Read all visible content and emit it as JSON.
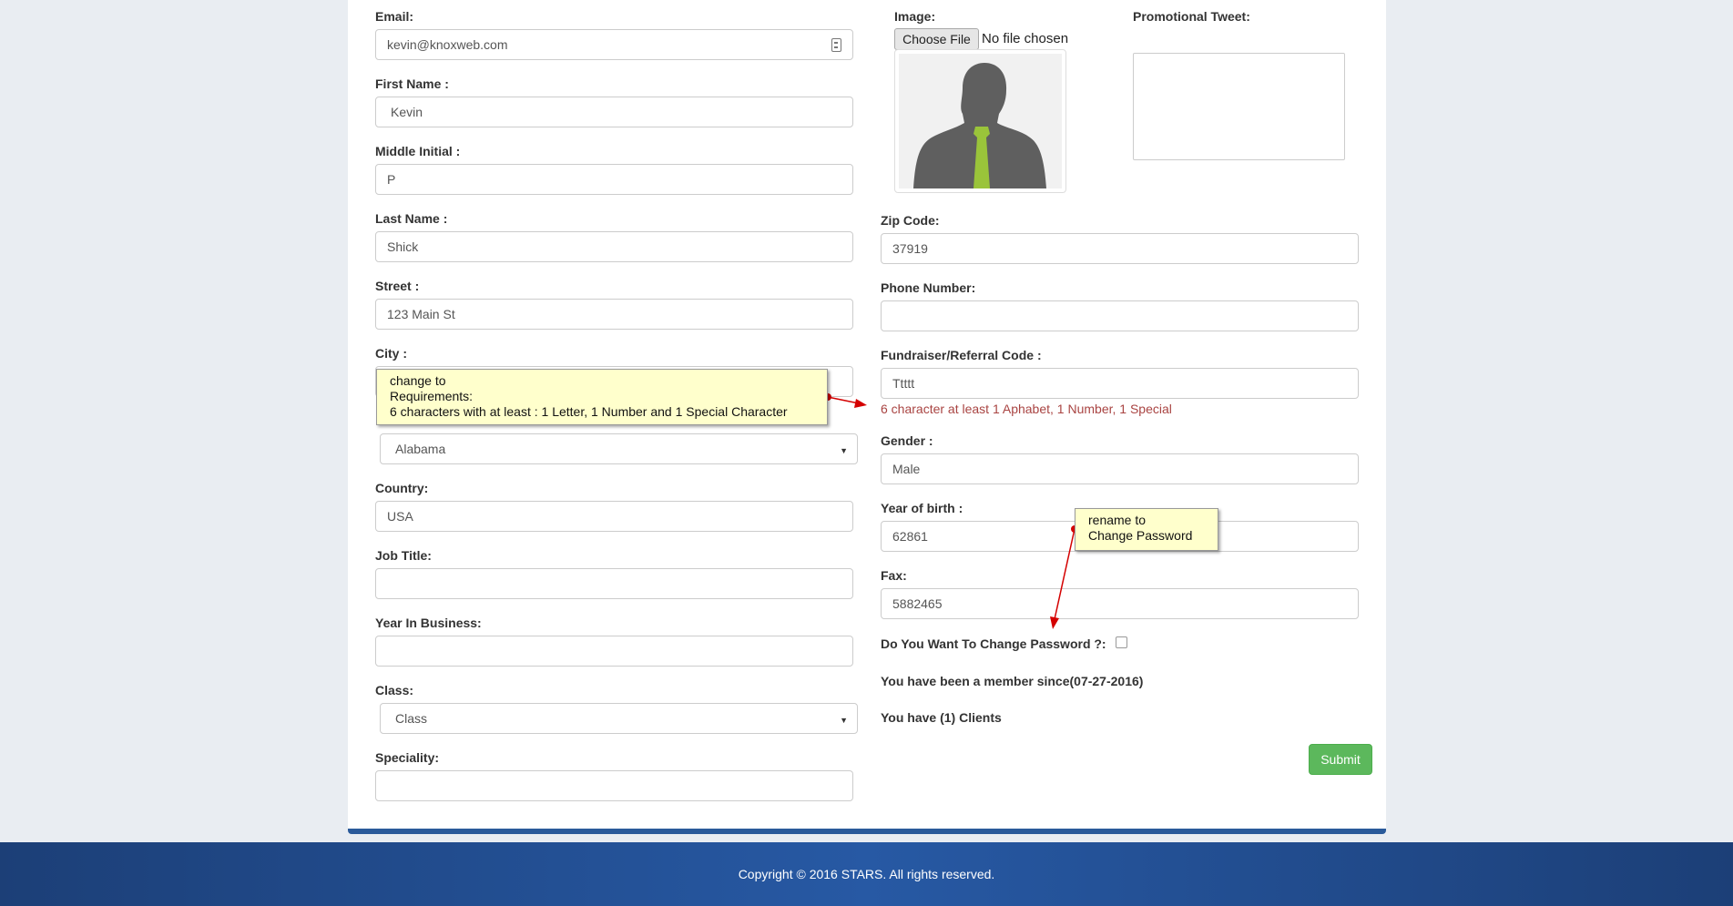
{
  "left": {
    "email": {
      "label": "Email:",
      "value": "kevin@knoxweb.com"
    },
    "first_name": {
      "label": "First Name :",
      "value": "Kevin"
    },
    "middle_initial": {
      "label": "Middle Initial :",
      "value": "P"
    },
    "last_name": {
      "label": "Last Name :",
      "value": "Shick"
    },
    "street": {
      "label": "Street :",
      "value": "123 Main St"
    },
    "city": {
      "label": "City :",
      "value": ""
    },
    "state": {
      "value": "Alabama"
    },
    "country": {
      "label": "Country:",
      "value": "USA"
    },
    "job_title": {
      "label": "Job Title:",
      "value": ""
    },
    "year_in_business": {
      "label": "Year In Business:",
      "value": ""
    },
    "class": {
      "label": "Class:",
      "value": "Class"
    },
    "speciality": {
      "label": "Speciality:",
      "value": ""
    }
  },
  "right": {
    "image": {
      "label": "Image:",
      "button": "Choose File",
      "status": "No file chosen"
    },
    "promotional_tweet": {
      "label": "Promotional Tweet:",
      "value": ""
    },
    "zip_code": {
      "label": "Zip Code:",
      "value": "37919"
    },
    "phone_number": {
      "label": "Phone Number:",
      "value": ""
    },
    "referral_code": {
      "label": "Fundraiser/Referral Code :",
      "value": "Ttttt",
      "error": "6 character at least 1 Aphabet, 1 Number, 1 Special"
    },
    "gender": {
      "label": "Gender :",
      "value": "Male"
    },
    "year_of_birth": {
      "label": "Year of birth :",
      "value": "62861"
    },
    "fax": {
      "label": "Fax:",
      "value": "5882465"
    },
    "change_password": {
      "label": "Do You Want To Change Password ?:",
      "checked": false
    },
    "member_since": "You have been a member since(07-27-2016)",
    "clients": "You have (1) Clients",
    "submit": "Submit"
  },
  "notes": {
    "requirements": {
      "line1": "change to",
      "line2": "Requirements:",
      "line3": "6 characters with at least :  1 Letter, 1 Number and 1 Special Character"
    },
    "rename": {
      "line1": "rename to",
      "line2": "Change Password"
    }
  },
  "footer": {
    "copyright": "Copyright © 2016 STARS. All rights reserved."
  },
  "colors": {
    "submit": "#5cb85c",
    "error": "#a94442",
    "footer": "#2759a4",
    "note_bg": "#ffffcc",
    "arrow": "#d40000"
  }
}
